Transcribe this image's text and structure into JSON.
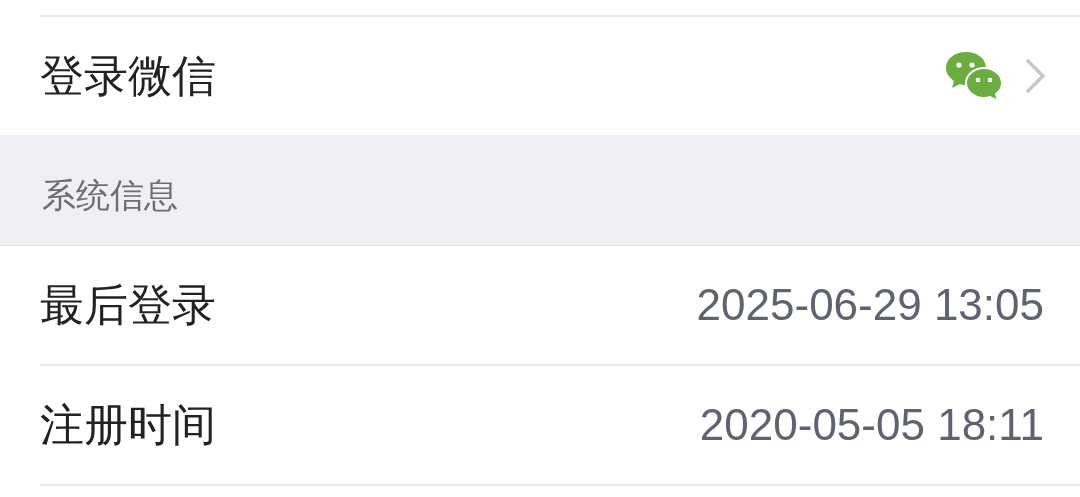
{
  "sections": [
    {
      "kind": "group",
      "rows": [
        {
          "kind": "link",
          "label": "登录微信"
        }
      ]
    },
    {
      "kind": "header",
      "title": "系统信息",
      "rows": [
        {
          "kind": "value",
          "label": "最后登录",
          "value": "2025-06-29 13:05"
        },
        {
          "kind": "value",
          "label": "注册时间",
          "value": "2020-05-05 18:11"
        }
      ]
    }
  ]
}
